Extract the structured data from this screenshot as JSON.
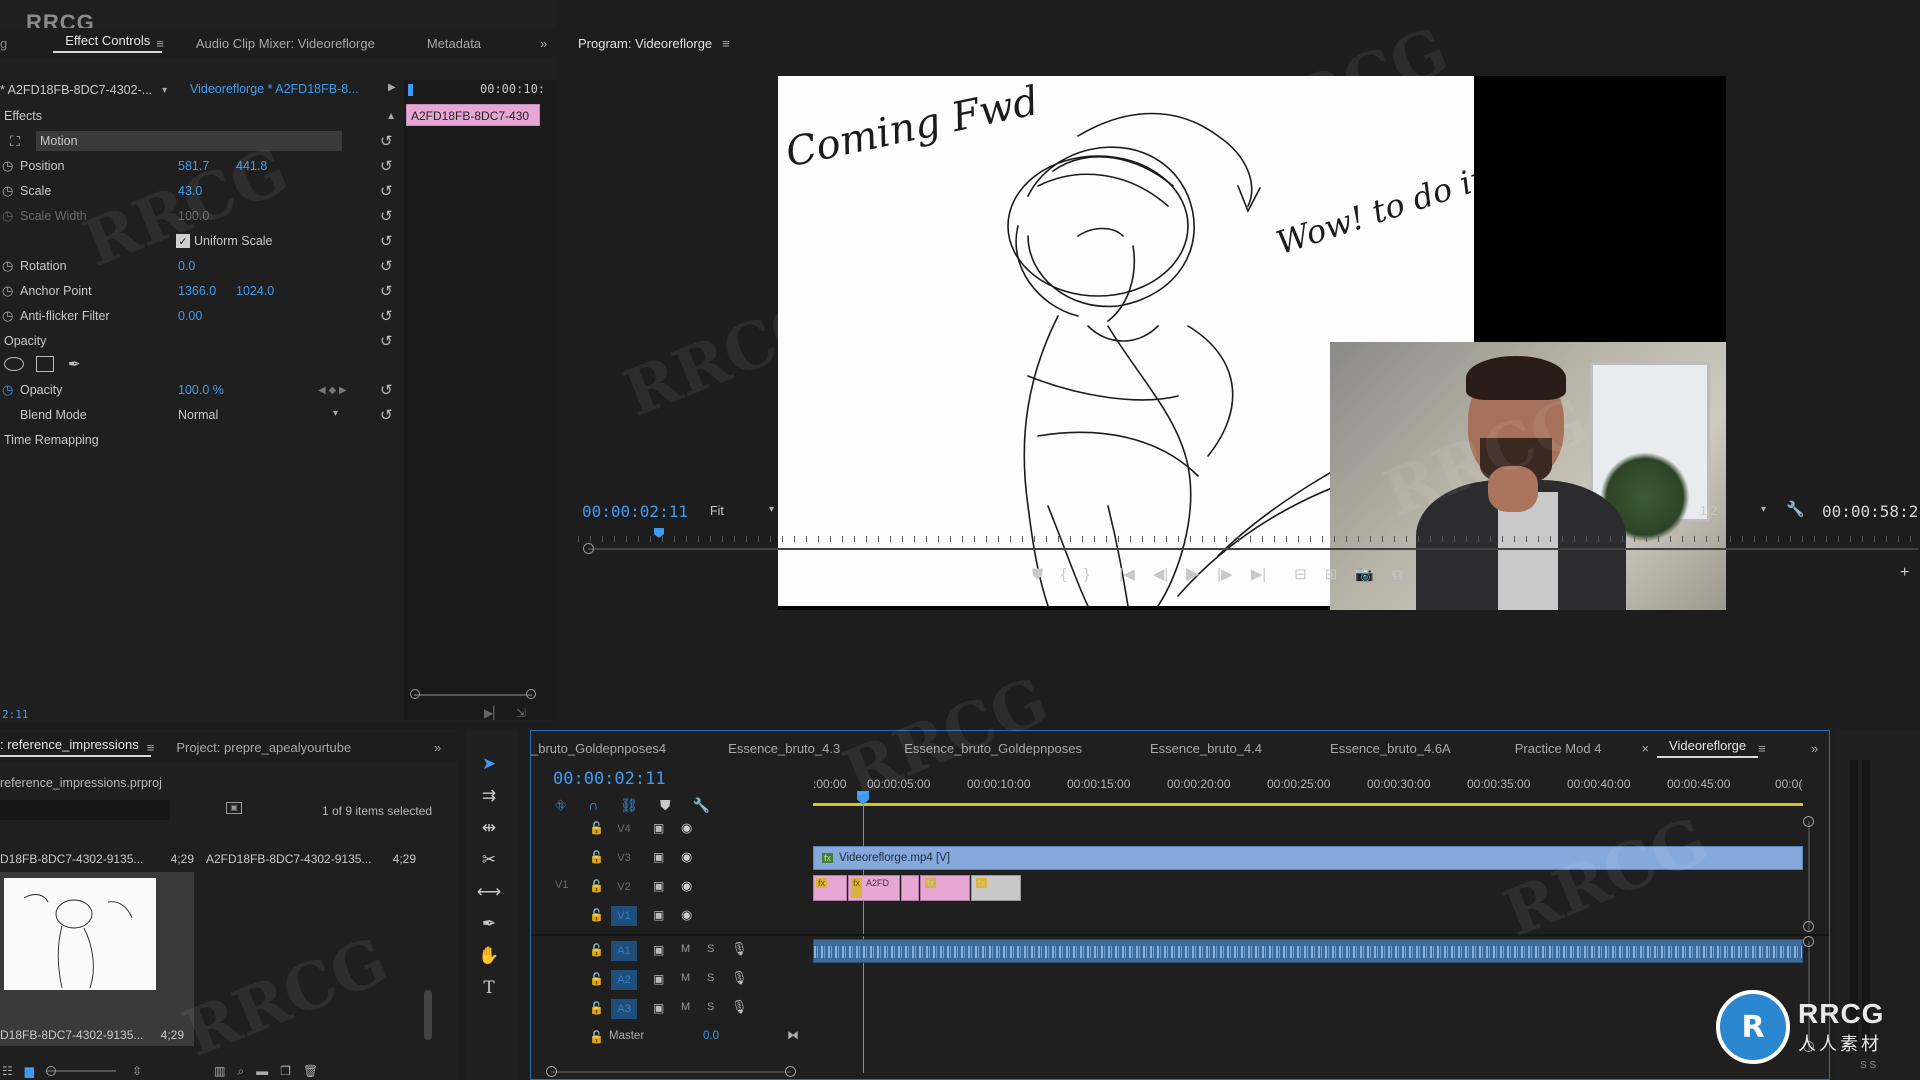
{
  "brand": {
    "watermark_corner": "RRCG",
    "logo_text": "RRCG",
    "logo_sub": "人人素材"
  },
  "top_left_panel": {
    "tabs": [
      "Effect Controls",
      "Audio Clip Mixer: Videoreflorge",
      "Metadata"
    ],
    "source_clip": "* A2FD18FB-8DC7-4302-...",
    "sequence_clip": "Videoreflorge * A2FD18FB-8...",
    "mini_timecode": "00:00:10:",
    "clip_tooltip": "A2FD18FB-8DC7-430",
    "section_effects": "Effects",
    "motion_label": "Motion",
    "properties": [
      {
        "name": "Position",
        "v1": "581.7",
        "v2": "441.8"
      },
      {
        "name": "Scale",
        "v1": "43.0",
        "v2": ""
      },
      {
        "name": "Scale Width",
        "v1": "100.0",
        "v2": ""
      },
      {
        "name": "Rotation",
        "v1": "0.0",
        "v2": ""
      },
      {
        "name": "Anchor Point",
        "v1": "1366.0",
        "v2": "1024.0"
      },
      {
        "name": "Anti-flicker Filter",
        "v1": "0.00",
        "v2": ""
      }
    ],
    "uniform_scale": "Uniform Scale",
    "opacity_section": "Opacity",
    "opacity_label": "Opacity",
    "opacity_value": "100.0 %",
    "blend_mode_label": "Blend Mode",
    "blend_mode_value": "Normal",
    "time_remapping": "Time Remapping",
    "bottom_timecode": "2:11"
  },
  "program_monitor": {
    "title": "Program: Videoreflorge",
    "timecode": "00:00:02:11",
    "fit": "Fit",
    "resolution": "1/2",
    "duration": "00:00:58:2(",
    "sketch_text_left": "Coming Fwd",
    "sketch_text_right": "Wow! to do impressions"
  },
  "project_panel": {
    "tabs": [
      ": reference_impressions",
      "Project: prepre_apealyourtube"
    ],
    "file_name": "reference_impressions.prproj",
    "items_selected": "1 of 9 items selected",
    "items": [
      {
        "name": "D18FB-8DC7-4302-9135...",
        "dur": "4;29"
      },
      {
        "name": "A2FD18FB-8DC7-4302-9135...",
        "dur": "4;29"
      }
    ],
    "thumb_label": "D18FB-8DC7-4302-9135...",
    "thumb_dur": "4;29"
  },
  "timeline": {
    "tabs": [
      "_bruto_Goldepnposes4",
      "Essence_bruto_4.3",
      "Essence_bruto_Goldepnposes",
      "Essence_bruto_4.4",
      "Essence_bruto_4.6A",
      "Practice Mod 4",
      "Videoreflorge"
    ],
    "timecode": "00:00:02:11",
    "ruler": [
      ":00:00",
      "00:00:05:00",
      "00:00:10:00",
      "00:00:15:00",
      "00:00:20:00",
      "00:00:25:00",
      "00:00:30:00",
      "00:00:35:00",
      "00:00:40:00",
      "00:00:45:00",
      "00:0("
    ],
    "video_tracks": [
      "V4",
      "V3",
      "V2",
      "V1"
    ],
    "audio_tracks": [
      "A1",
      "A2",
      "A3"
    ],
    "source_patch": "V1",
    "master_label": "Master",
    "master_value": "0.0",
    "clip_v3": "Videoreflorge.mp4 [V]",
    "clip_v2_label": "A2FD",
    "fx": "fx",
    "m": "M",
    "s": "S"
  },
  "colors": {
    "accent": "#3f9bf0",
    "clip_video": "#86a9dc",
    "clip_pink": "#e6a7d4",
    "audio": "#3c6b9c"
  }
}
